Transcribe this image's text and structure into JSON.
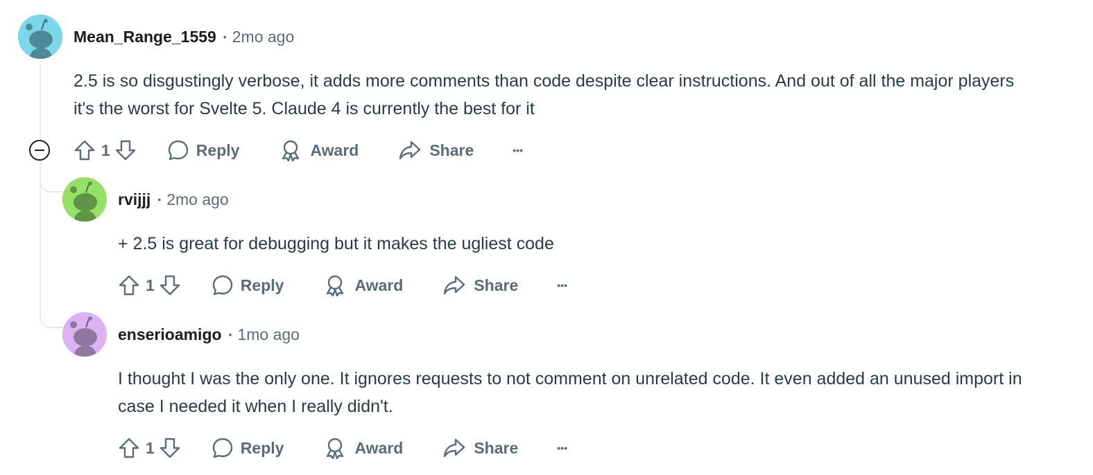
{
  "comments": [
    {
      "username": "Mean_Range_1559",
      "separator": "•",
      "time": "2mo ago",
      "avatar_color": "#7dd7ea",
      "text": "2.5 is so disgustingly verbose, it adds more comments than code despite clear instructions. And out of all the major players it's the worst for Svelte 5. Claude 4 is currently the best for it",
      "votes": "1",
      "reply_label": "Reply",
      "award_label": "Award",
      "share_label": "Share",
      "more_label": "•••"
    },
    {
      "username": "rvijjj",
      "separator": "•",
      "time": "2mo ago",
      "avatar_color": "#94e068",
      "text": "+ 2.5 is great for debugging but it makes the ugliest code",
      "votes": "1",
      "reply_label": "Reply",
      "award_label": "Award",
      "share_label": "Share",
      "more_label": "•••"
    },
    {
      "username": "enserioamigo",
      "separator": "•",
      "time": "1mo ago",
      "avatar_color": "#dcb2f2",
      "text": "I thought I was the only one. It ignores requests to not comment on unrelated code. It even added an unused import in case I needed it when I really didn't.",
      "votes": "1",
      "reply_label": "Reply",
      "award_label": "Award",
      "share_label": "Share",
      "more_label": "•••"
    }
  ],
  "icons": {
    "upvote": "arrow-up-outline",
    "downvote": "arrow-down-outline",
    "reply": "speech-bubble",
    "award": "ribbon-award",
    "share": "share-arrow",
    "collapse": "minus-circle"
  }
}
